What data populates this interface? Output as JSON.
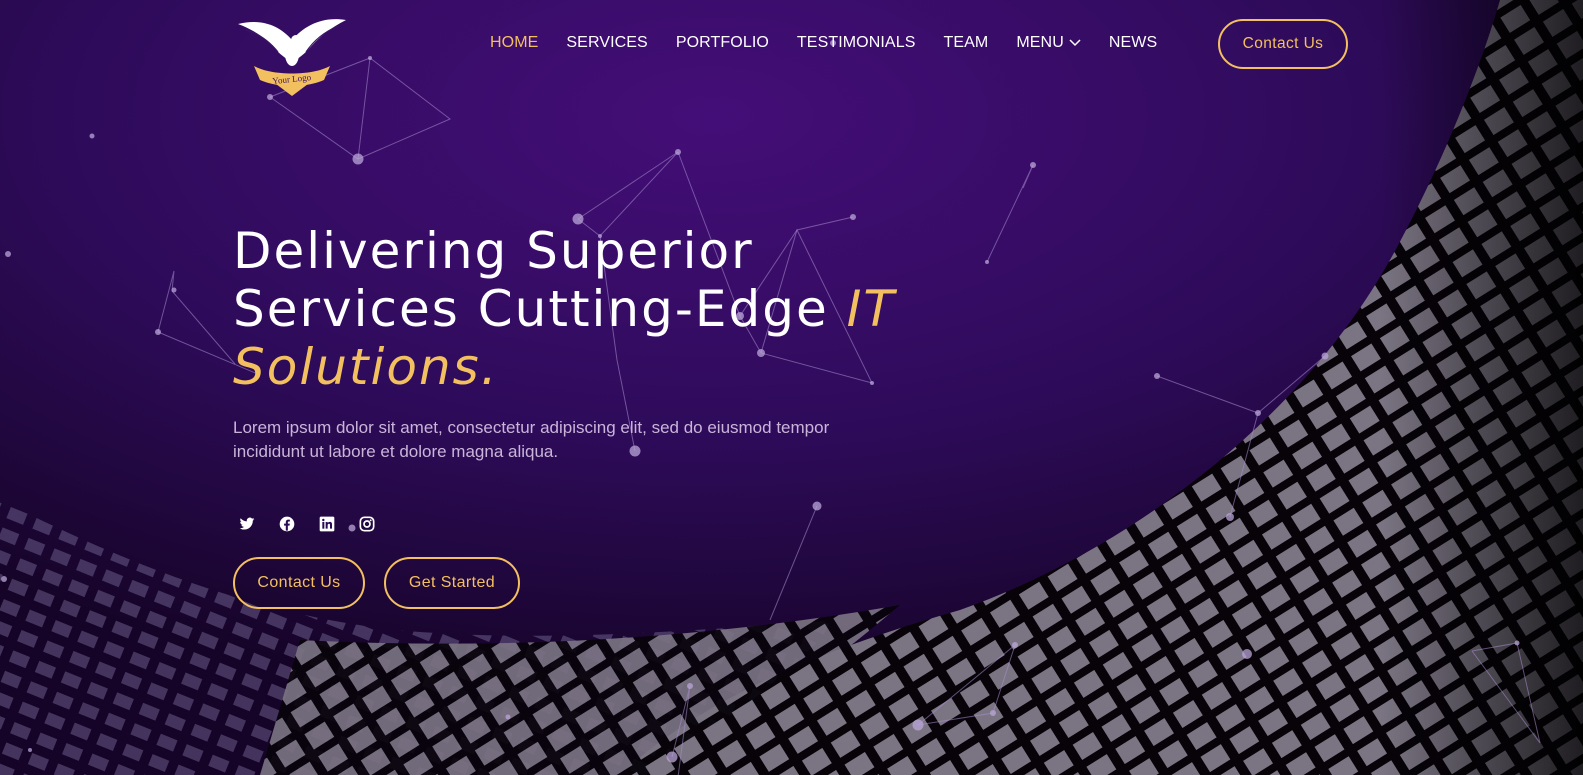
{
  "nav": {
    "items": [
      {
        "label": "HOME",
        "active": true
      },
      {
        "label": "SERVICES"
      },
      {
        "label": "PORTFOLIO"
      },
      {
        "label": "TESTIMONIALS"
      },
      {
        "label": "TEAM"
      },
      {
        "label": "MENU",
        "has_dropdown": true
      },
      {
        "label": "NEWS"
      }
    ],
    "contact_button": "Contact Us"
  },
  "logo": {
    "text": "Your Logo",
    "icon": "eagle-emblem-icon"
  },
  "hero": {
    "title_line1": "Delivering Superior",
    "title_line2": "Services Cutting-Edge ",
    "title_accent_1": "IT",
    "title_accent_2": "Solutions.",
    "description": "Lorem ipsum dolor sit amet, consectetur adipiscing elit, sed do eiusmod tempor incididunt ut labore et dolore magna aliqua.",
    "buttons": {
      "contact": "Contact Us",
      "get_started": "Get Started"
    }
  },
  "socials": [
    "twitter-icon",
    "facebook-icon",
    "linkedin-icon",
    "instagram-icon"
  ],
  "colors": {
    "background": "#2a0a52",
    "accent": "#f3c060",
    "text": "#ffffff",
    "muted_text": "#c9b5da"
  }
}
